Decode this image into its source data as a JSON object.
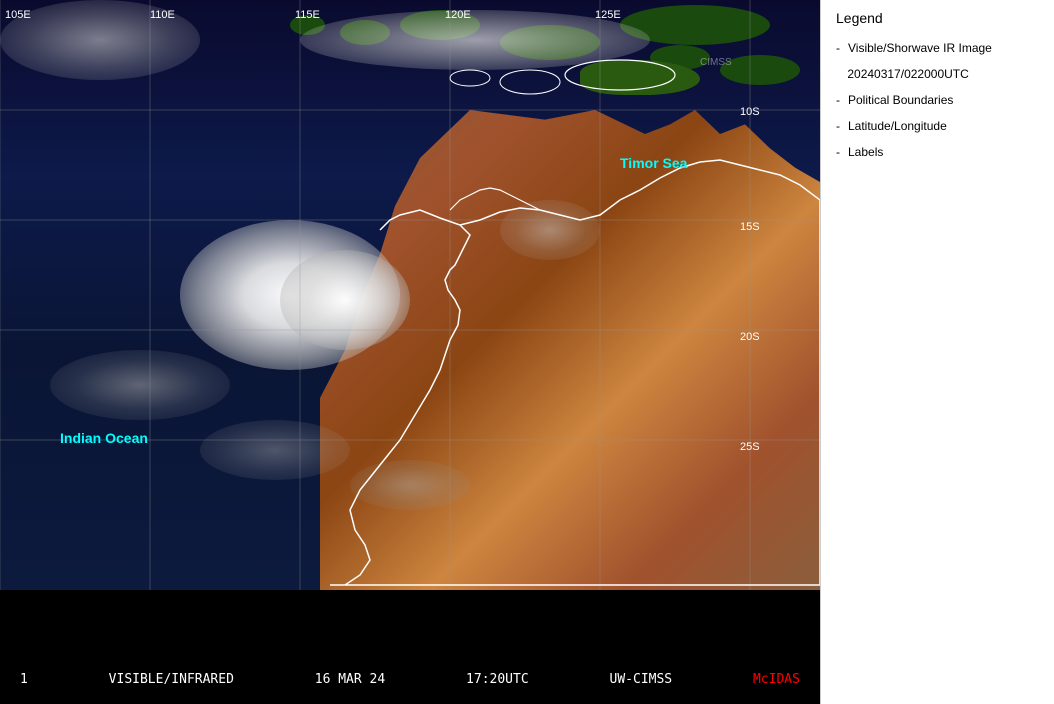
{
  "legend": {
    "title": "Legend",
    "items": [
      {
        "label": "Visible/Shorwave IR Image",
        "dash": "-"
      },
      {
        "label": "20240317/022000UTC",
        "dash": ""
      },
      {
        "label": "Political Boundaries",
        "dash": "-"
      },
      {
        "label": "Latitude/Longitude",
        "dash": "-"
      },
      {
        "label": "Labels",
        "dash": "-"
      }
    ]
  },
  "status_bar": {
    "frame_number": "1",
    "image_type": "VISIBLE/INFRARED",
    "date": "16 MAR 24",
    "time": "17:20UTC",
    "station": "UW-CIMSS",
    "software": "McIDAS"
  },
  "map": {
    "timor_sea_label": "Timor Sea",
    "indian_ocean_label": "Indian Ocean",
    "lon_labels": [
      "105E",
      "110E",
      "115E",
      "120E",
      "125E"
    ],
    "lat_labels": [
      "10S",
      "15S",
      "20S",
      "25S"
    ]
  }
}
